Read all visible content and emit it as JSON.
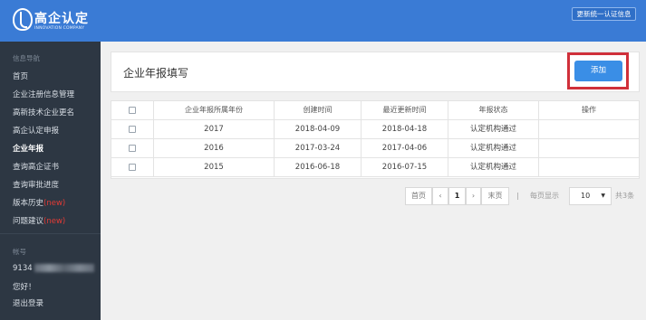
{
  "brand": {
    "title": "高企认定",
    "subtitle": "INNOVATION COMPANY"
  },
  "top_action": "更新统一认证信息",
  "sidebar": {
    "section_title": "信息导航",
    "items": [
      {
        "label": "首页",
        "new": ""
      },
      {
        "label": "企业注册信息管理",
        "new": ""
      },
      {
        "label": "高新技术企业更名",
        "new": ""
      },
      {
        "label": "高企认定申报",
        "new": ""
      },
      {
        "label": "企业年报",
        "new": ""
      },
      {
        "label": "查询高企证书",
        "new": ""
      },
      {
        "label": "查询审批进度",
        "new": ""
      },
      {
        "label": "版本历史",
        "new": "(new)"
      },
      {
        "label": "问题建议",
        "new": "(new)"
      }
    ],
    "account_section_title": "帐号",
    "account_id_prefix": "9134",
    "greeting": "您好！",
    "logout": "退出登录"
  },
  "panel": {
    "title": "企业年报填写",
    "add_button": "添加"
  },
  "table": {
    "columns": [
      "",
      "企业年报所属年份",
      "创建时间",
      "最近更新时间",
      "年报状态",
      "操作"
    ],
    "rows": [
      [
        "",
        "2017",
        "2018-04-09",
        "2018-04-18",
        "认定机构通过",
        ""
      ],
      [
        "",
        "2016",
        "2017-03-24",
        "2017-04-06",
        "认定机构通过",
        ""
      ],
      [
        "",
        "2015",
        "2016-06-18",
        "2016-07-15",
        "认定机构通过",
        ""
      ]
    ]
  },
  "pagination": {
    "first": "首页",
    "prev": "‹",
    "current": "1",
    "next": "›",
    "last": "末页",
    "sep": "|",
    "per_page_label": "每页显示",
    "per_page": "10",
    "total": "共3条"
  },
  "colors": {
    "accent": "#3a7bd5",
    "sidebar": "#2d3743",
    "highlight": "#d0303a",
    "new": "#e53b35"
  }
}
